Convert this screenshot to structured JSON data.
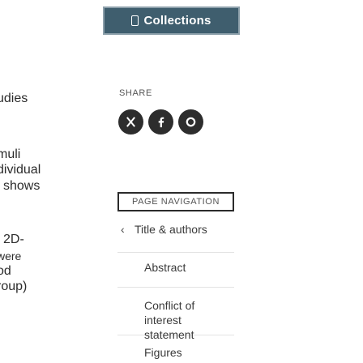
{
  "left_fragments": [
    "udies",
    "muli",
    "dividual",
    "l shows",
    "2D-",
    "were",
    "od",
    "roup)"
  ],
  "toolbar": {
    "collections_label": "Collections"
  },
  "share": {
    "label": "SHARE",
    "icons": [
      "x-icon",
      "facebook-icon",
      "linkedin-icon"
    ]
  },
  "page_navigation": {
    "label": "PAGE NAVIGATION",
    "items": [
      {
        "label": "Title & authors",
        "icon": "chevron-left-icon"
      },
      {
        "label": "Abstract"
      },
      {
        "label": "Conflict of interest statement"
      },
      {
        "label": "Figures"
      }
    ]
  }
}
